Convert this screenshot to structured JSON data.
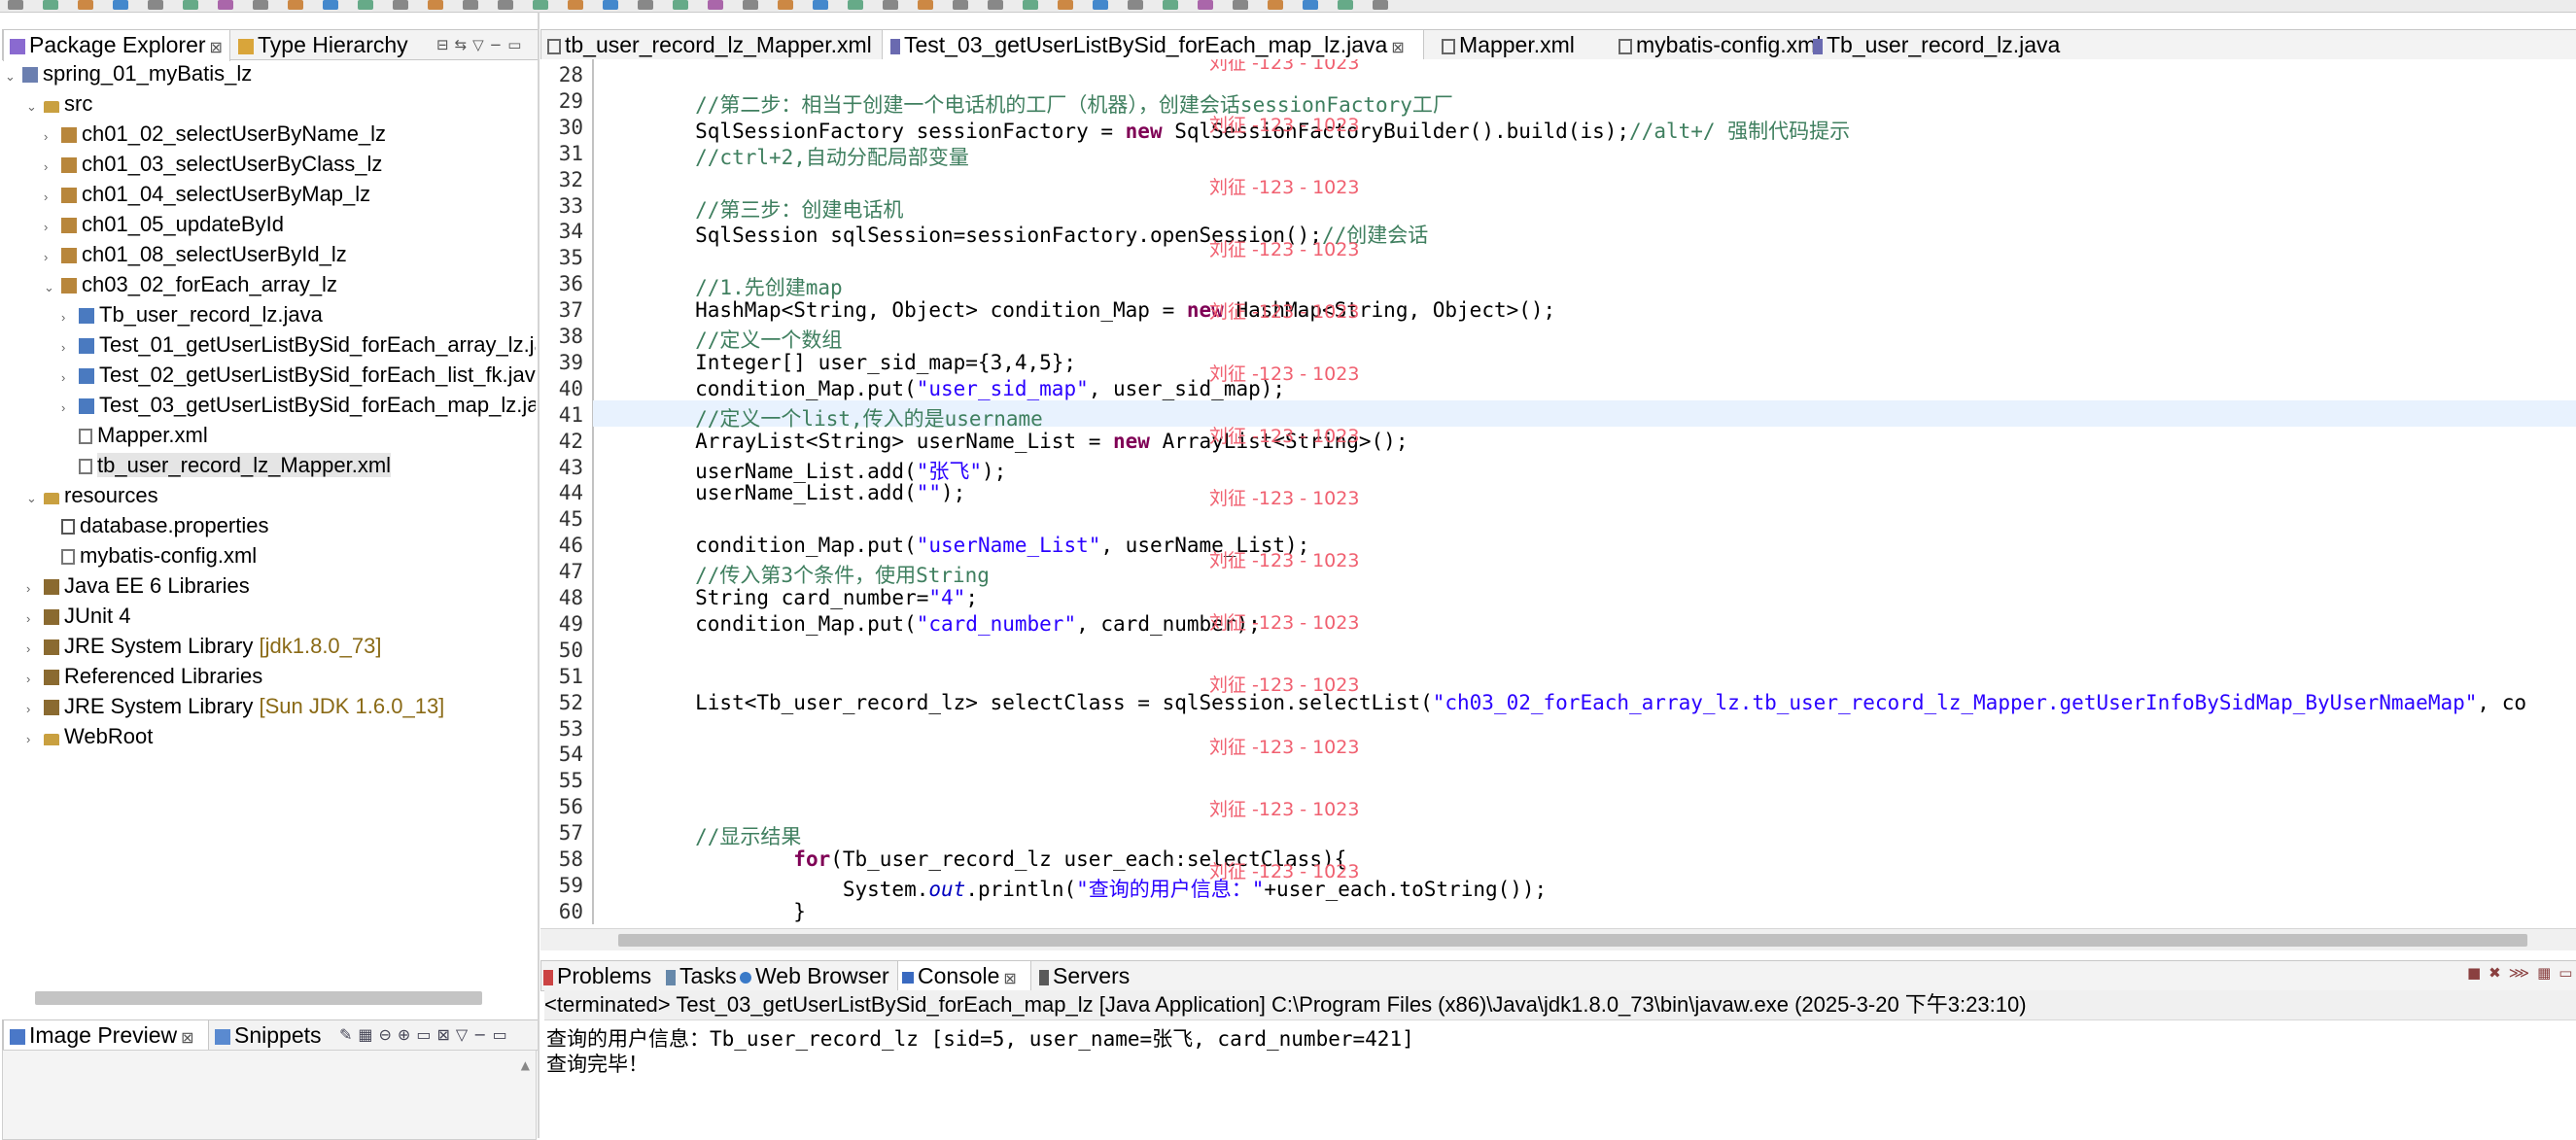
{
  "left_panel": {
    "tabs": [
      {
        "label": "Package Explorer",
        "active": true
      },
      {
        "label": "Type Hierarchy",
        "active": false
      }
    ],
    "tree": [
      {
        "label": "spring_01_myBatis_lz",
        "suffix": ""
      },
      {
        "label": "src",
        "suffix": ""
      },
      {
        "label": "ch01_02_selectUserByName_lz",
        "suffix": ""
      },
      {
        "label": "ch01_03_selectUserByClass_lz",
        "suffix": ""
      },
      {
        "label": "ch01_04_selectUserByMap_lz",
        "suffix": ""
      },
      {
        "label": "ch01_05_updateById",
        "suffix": ""
      },
      {
        "label": "ch01_08_selectUserById_lz",
        "suffix": ""
      },
      {
        "label": "ch03_02_forEach_array_lz",
        "suffix": ""
      },
      {
        "label": "Tb_user_record_lz.java",
        "suffix": ""
      },
      {
        "label": "Test_01_getUserListBySid_forEach_array_lz.java",
        "suffix": ""
      },
      {
        "label": "Test_02_getUserListBySid_forEach_list_fk.java",
        "suffix": ""
      },
      {
        "label": "Test_03_getUserListBySid_forEach_map_lz.java",
        "suffix": ""
      },
      {
        "label": "Mapper.xml",
        "suffix": ""
      },
      {
        "label": "tb_user_record_lz_Mapper.xml",
        "suffix": ""
      },
      {
        "label": "resources",
        "suffix": ""
      },
      {
        "label": "database.properties",
        "suffix": ""
      },
      {
        "label": "mybatis-config.xml",
        "suffix": ""
      },
      {
        "label": "Java EE 6 Libraries",
        "suffix": ""
      },
      {
        "label": "JUnit 4",
        "suffix": ""
      },
      {
        "label": "JRE System Library",
        "suffix": "[jdk1.8.0_73]"
      },
      {
        "label": "Referenced Libraries",
        "suffix": ""
      },
      {
        "label": "JRE System Library",
        "suffix": "[Sun JDK 1.6.0_13]"
      },
      {
        "label": "WebRoot",
        "suffix": ""
      }
    ]
  },
  "bottom_left": {
    "tabs": [
      {
        "label": "Image Preview",
        "active": true
      },
      {
        "label": "Snippets",
        "active": false
      }
    ]
  },
  "editor": {
    "tabs": [
      {
        "label": "tb_user_record_lz_Mapper.xml",
        "active": false
      },
      {
        "label": "Test_03_getUserListBySid_forEach_map_lz.java",
        "active": true
      },
      {
        "label": "Mapper.xml",
        "active": false
      },
      {
        "label": "mybatis-config.xml",
        "active": false
      },
      {
        "label": "Tb_user_record_lz.java",
        "active": false
      }
    ],
    "line_numbers": [
      "28",
      "29",
      "30",
      "31",
      "32",
      "33",
      "34",
      "35",
      "36",
      "37",
      "38",
      "39",
      "40",
      "41",
      "42",
      "43",
      "44",
      "45",
      "46",
      "47",
      "48",
      "49",
      "50",
      "51",
      "52",
      "53",
      "54",
      "55",
      "56",
      "57",
      "58",
      "59",
      "60"
    ],
    "lines": [
      [],
      [
        [
          "cm",
          "        //第二步：相当于创建一个电话机的工厂（机器），创建会话sessionFactory工厂"
        ]
      ],
      [
        [
          "t",
          "        SqlSessionFactory sessionFactory = "
        ],
        [
          "kw",
          "new"
        ],
        [
          "t",
          " SqlSessionFactoryBuilder().build(is);"
        ],
        [
          "cm",
          "//alt+/ 强制代码提示"
        ]
      ],
      [
        [
          "cm",
          "        //ctrl+2,自动分配局部变量"
        ]
      ],
      [],
      [
        [
          "cm",
          "        //第三步：创建电话机"
        ]
      ],
      [
        [
          "t",
          "        SqlSession sqlSession=sessionFactory.openSession();"
        ],
        [
          "cm",
          "//创建会话"
        ]
      ],
      [],
      [
        [
          "cm",
          "        //1.先创建map"
        ]
      ],
      [
        [
          "t",
          "        HashMap<String, Object> condition_Map = "
        ],
        [
          "kw",
          "new"
        ],
        [
          "t",
          " HashMap<String, Object>();"
        ]
      ],
      [
        [
          "cm",
          "        //定义一个数组"
        ]
      ],
      [
        [
          "t",
          "        Integer[] user_sid_map={3,4,5};"
        ]
      ],
      [
        [
          "t",
          "        condition_Map.put("
        ],
        [
          "str",
          "\"user_sid_map\""
        ],
        [
          "t",
          ", user_sid_map);"
        ]
      ],
      [
        [
          "cm",
          "        //定义一个list,传入的是username"
        ]
      ],
      [
        [
          "t",
          "        ArrayList<String> userName_List = "
        ],
        [
          "kw",
          "new"
        ],
        [
          "t",
          " ArrayList<String>();"
        ]
      ],
      [
        [
          "t",
          "        userName_List.add("
        ],
        [
          "str",
          "\"张飞\""
        ],
        [
          "t",
          ");"
        ]
      ],
      [
        [
          "t",
          "        userName_List.add("
        ],
        [
          "str",
          "\"\""
        ],
        [
          "t",
          ");"
        ]
      ],
      [],
      [
        [
          "t",
          "        condition_Map.put("
        ],
        [
          "str",
          "\"userName_List\""
        ],
        [
          "t",
          ", userName_List);"
        ]
      ],
      [
        [
          "cm",
          "        //传入第3个条件，使用String"
        ]
      ],
      [
        [
          "t",
          "        String card_number="
        ],
        [
          "str",
          "\"4\""
        ],
        [
          "t",
          ";"
        ]
      ],
      [
        [
          "t",
          "        condition_Map.put("
        ],
        [
          "str",
          "\"card_number\""
        ],
        [
          "t",
          ", card_number);"
        ]
      ],
      [],
      [],
      [
        [
          "t",
          "        List<Tb_user_record_lz> selectClass = sqlSession.selectList("
        ],
        [
          "str",
          "\"ch03_02_forEach_array_lz.tb_user_record_lz_Mapper.getUserInfoBySidMap_ByUserNmaeMap\""
        ],
        [
          "t",
          ", co"
        ]
      ],
      [],
      [],
      [],
      [],
      [
        [
          "cm",
          "        //显示结果"
        ]
      ],
      [
        [
          "t",
          "                "
        ],
        [
          "kw",
          "for"
        ],
        [
          "t",
          "(Tb_user_record_lz user_each:selectClass){"
        ]
      ],
      [
        [
          "t",
          "                    System."
        ],
        [
          "it",
          "out"
        ],
        [
          "t",
          ".println("
        ],
        [
          "str",
          "\"查询的用户信息：\""
        ],
        [
          "t",
          "+user_each.toString());"
        ]
      ],
      [
        [
          "t",
          "                }"
        ]
      ]
    ],
    "watermark": "刘征 -123 - 1023"
  },
  "bottom_panel": {
    "tabs": [
      {
        "label": "Problems",
        "active": false
      },
      {
        "label": "Tasks",
        "active": false
      },
      {
        "label": "Web Browser",
        "active": false
      },
      {
        "label": "Console",
        "active": true
      },
      {
        "label": "Servers",
        "active": false
      }
    ],
    "status_line": "<terminated> Test_03_getUserListBySid_forEach_map_lz [Java Application] C:\\Program Files (x86)\\Java\\jdk1.8.0_73\\bin\\javaw.exe (2025-3-20 下午3:23:10)",
    "output": [
      "查询的用户信息：Tb_user_record_lz [sid=5, user_name=张飞, card_number=421]",
      "查询完毕！"
    ]
  },
  "colors": {
    "keyword": "#7f0055",
    "string": "#2a00ff",
    "comment": "#3f7f5f",
    "watermark": "#f06070"
  }
}
